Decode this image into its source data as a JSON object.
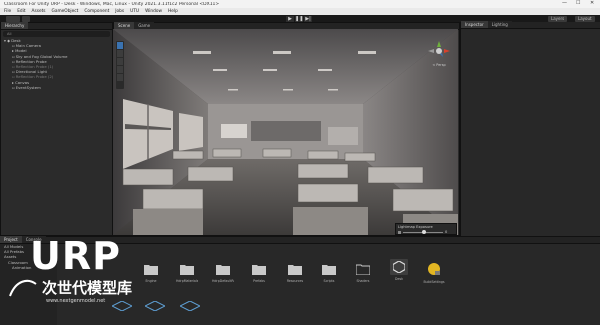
{
  "window": {
    "title": "Classroom For Unity URP - Desk - Windows, Mac, Linux - Unity 2021.3.11f1c2 Personal <DX11>",
    "min": "—",
    "max": "☐",
    "close": "✕"
  },
  "menu": [
    "File",
    "Edit",
    "Assets",
    "GameObject",
    "Component",
    "Jobs",
    "UTU",
    "Window",
    "Help"
  ],
  "toolbar": {
    "layers": "Layers",
    "layout": "Layout"
  },
  "hierarchy": {
    "tab": "Hierarchy",
    "search_placeholder": "All",
    "items": [
      {
        "label": "Desk",
        "dim": false
      },
      {
        "label": "Main Camera",
        "dim": false
      },
      {
        "label": "Model",
        "dim": false
      },
      {
        "label": "Sky and Fog Global Volume",
        "dim": false
      },
      {
        "label": "Reflection Probe",
        "dim": false
      },
      {
        "label": "Reflection Probe (1)",
        "dim": true
      },
      {
        "label": "Directional Light",
        "dim": false
      },
      {
        "label": "Reflection Probe (2)",
        "dim": true
      },
      {
        "label": "Canvas",
        "dim": false
      },
      {
        "label": "EventSystem",
        "dim": false
      }
    ]
  },
  "center_tabs": [
    "Scene",
    "Game"
  ],
  "right_tabs": [
    "Inspector",
    "Lighting"
  ],
  "gizmo": {
    "label": "< Persp"
  },
  "lightmap": {
    "title": "Lightmap Exposure",
    "value": "0"
  },
  "project": {
    "tabs": [
      "Project",
      "Console"
    ],
    "tree": [
      "All Models",
      "All Prefabs",
      "Assets",
      "Classroom",
      "Animation"
    ],
    "folders": [
      {
        "label": "Engine"
      },
      {
        "label": "HdrpMaterials"
      },
      {
        "label": "HdrpDefaultRes"
      },
      {
        "label": "Prefabs"
      },
      {
        "label": "Resources"
      },
      {
        "label": "Scripts"
      },
      {
        "label": "Shaders"
      },
      {
        "label": "Desk"
      },
      {
        "label": "BuildSettings"
      }
    ]
  },
  "watermark": {
    "big": "URP",
    "cn": "次世代模型库",
    "sub": "www.nextgenmodel.net"
  },
  "colors": {
    "accent": "#3a72b0",
    "folder": "#c9c9c9",
    "bg": "#191919"
  }
}
